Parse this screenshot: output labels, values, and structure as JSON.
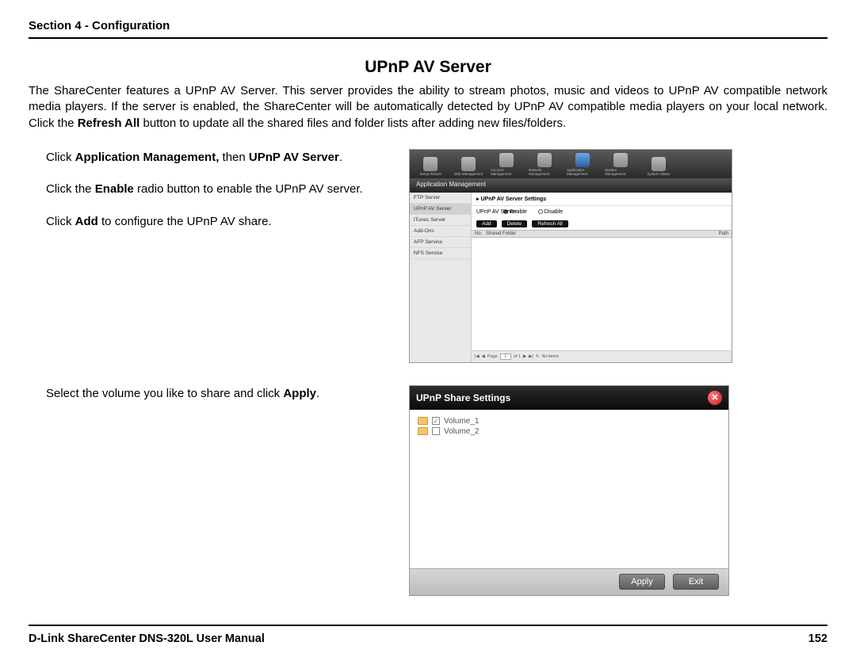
{
  "header": {
    "section": "Section 4 - Configuration"
  },
  "title": "UPnP AV Server",
  "intro": {
    "t1": "The ShareCenter features a UPnP AV Server. This server provides the ability to stream photos, music and videos to UPnP AV compatible network media players. If the server is enabled, the ShareCenter will be automatically detected by UPnP AV compatible media players on your local network. Click the ",
    "b1": "Refresh All",
    "t2": " button to update all the shared files and folder lists after adding new files/folders."
  },
  "instr1": {
    "l1a": "Click ",
    "l1b": "Application Management,",
    "l1c": " then ",
    "l1d": "UPnP AV Server",
    "l1e": ".",
    "l2a": "Click the ",
    "l2b": "Enable",
    "l2c": " radio button to enable the UPnP AV server.",
    "l3a": "Click ",
    "l3b": "Add",
    "l3c": " to configure the UPnP AV share."
  },
  "instr2": {
    "a": "Select the volume you like to share and click ",
    "b": "Apply",
    "c": "."
  },
  "ss1": {
    "topIcons": [
      "Setup Wizard",
      "Disk Management",
      "Account Management",
      "Network Management",
      "Application Management",
      "System Management",
      "System Status"
    ],
    "barTitle": "Application Management",
    "side": [
      "FTP Server",
      "UPnP AV Server",
      "iTunes Server",
      "Add-Ons",
      "AFP Service",
      "NFS Service"
    ],
    "settingsTitle": "UPnP AV Server Settings",
    "labelName": "UPnP AV Server",
    "enable": "Enable",
    "disable": "Disable",
    "btns": [
      "Add",
      "Delete",
      "Refresh All"
    ],
    "col1": "No.",
    "col2": "Shared Folder",
    "col3": "Path",
    "pager": {
      "page": "Page",
      "pg": "1",
      "of": "of 1",
      "refresh": "↻",
      "noitems": "No items"
    }
  },
  "ss2": {
    "title": "UPnP Share Settings",
    "items": [
      {
        "label": "Volume_1",
        "checked": true
      },
      {
        "label": "Volume_2",
        "checked": false
      }
    ],
    "apply": "Apply",
    "exit": "Exit"
  },
  "footer": {
    "left": "D-Link ShareCenter DNS-320L User Manual",
    "right": "152"
  }
}
